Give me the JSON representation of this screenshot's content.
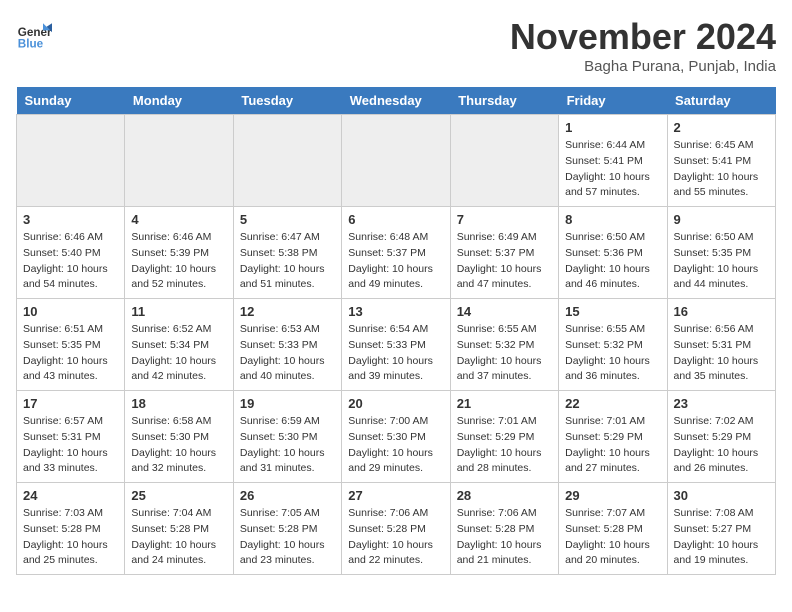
{
  "header": {
    "logo_line1": "General",
    "logo_line2": "Blue",
    "month": "November 2024",
    "location": "Bagha Purana, Punjab, India"
  },
  "weekdays": [
    "Sunday",
    "Monday",
    "Tuesday",
    "Wednesday",
    "Thursday",
    "Friday",
    "Saturday"
  ],
  "weeks": [
    [
      {
        "day": "",
        "info": ""
      },
      {
        "day": "",
        "info": ""
      },
      {
        "day": "",
        "info": ""
      },
      {
        "day": "",
        "info": ""
      },
      {
        "day": "",
        "info": ""
      },
      {
        "day": "1",
        "info": "Sunrise: 6:44 AM\nSunset: 5:41 PM\nDaylight: 10 hours\nand 57 minutes."
      },
      {
        "day": "2",
        "info": "Sunrise: 6:45 AM\nSunset: 5:41 PM\nDaylight: 10 hours\nand 55 minutes."
      }
    ],
    [
      {
        "day": "3",
        "info": "Sunrise: 6:46 AM\nSunset: 5:40 PM\nDaylight: 10 hours\nand 54 minutes."
      },
      {
        "day": "4",
        "info": "Sunrise: 6:46 AM\nSunset: 5:39 PM\nDaylight: 10 hours\nand 52 minutes."
      },
      {
        "day": "5",
        "info": "Sunrise: 6:47 AM\nSunset: 5:38 PM\nDaylight: 10 hours\nand 51 minutes."
      },
      {
        "day": "6",
        "info": "Sunrise: 6:48 AM\nSunset: 5:37 PM\nDaylight: 10 hours\nand 49 minutes."
      },
      {
        "day": "7",
        "info": "Sunrise: 6:49 AM\nSunset: 5:37 PM\nDaylight: 10 hours\nand 47 minutes."
      },
      {
        "day": "8",
        "info": "Sunrise: 6:50 AM\nSunset: 5:36 PM\nDaylight: 10 hours\nand 46 minutes."
      },
      {
        "day": "9",
        "info": "Sunrise: 6:50 AM\nSunset: 5:35 PM\nDaylight: 10 hours\nand 44 minutes."
      }
    ],
    [
      {
        "day": "10",
        "info": "Sunrise: 6:51 AM\nSunset: 5:35 PM\nDaylight: 10 hours\nand 43 minutes."
      },
      {
        "day": "11",
        "info": "Sunrise: 6:52 AM\nSunset: 5:34 PM\nDaylight: 10 hours\nand 42 minutes."
      },
      {
        "day": "12",
        "info": "Sunrise: 6:53 AM\nSunset: 5:33 PM\nDaylight: 10 hours\nand 40 minutes."
      },
      {
        "day": "13",
        "info": "Sunrise: 6:54 AM\nSunset: 5:33 PM\nDaylight: 10 hours\nand 39 minutes."
      },
      {
        "day": "14",
        "info": "Sunrise: 6:55 AM\nSunset: 5:32 PM\nDaylight: 10 hours\nand 37 minutes."
      },
      {
        "day": "15",
        "info": "Sunrise: 6:55 AM\nSunset: 5:32 PM\nDaylight: 10 hours\nand 36 minutes."
      },
      {
        "day": "16",
        "info": "Sunrise: 6:56 AM\nSunset: 5:31 PM\nDaylight: 10 hours\nand 35 minutes."
      }
    ],
    [
      {
        "day": "17",
        "info": "Sunrise: 6:57 AM\nSunset: 5:31 PM\nDaylight: 10 hours\nand 33 minutes."
      },
      {
        "day": "18",
        "info": "Sunrise: 6:58 AM\nSunset: 5:30 PM\nDaylight: 10 hours\nand 32 minutes."
      },
      {
        "day": "19",
        "info": "Sunrise: 6:59 AM\nSunset: 5:30 PM\nDaylight: 10 hours\nand 31 minutes."
      },
      {
        "day": "20",
        "info": "Sunrise: 7:00 AM\nSunset: 5:30 PM\nDaylight: 10 hours\nand 29 minutes."
      },
      {
        "day": "21",
        "info": "Sunrise: 7:01 AM\nSunset: 5:29 PM\nDaylight: 10 hours\nand 28 minutes."
      },
      {
        "day": "22",
        "info": "Sunrise: 7:01 AM\nSunset: 5:29 PM\nDaylight: 10 hours\nand 27 minutes."
      },
      {
        "day": "23",
        "info": "Sunrise: 7:02 AM\nSunset: 5:29 PM\nDaylight: 10 hours\nand 26 minutes."
      }
    ],
    [
      {
        "day": "24",
        "info": "Sunrise: 7:03 AM\nSunset: 5:28 PM\nDaylight: 10 hours\nand 25 minutes."
      },
      {
        "day": "25",
        "info": "Sunrise: 7:04 AM\nSunset: 5:28 PM\nDaylight: 10 hours\nand 24 minutes."
      },
      {
        "day": "26",
        "info": "Sunrise: 7:05 AM\nSunset: 5:28 PM\nDaylight: 10 hours\nand 23 minutes."
      },
      {
        "day": "27",
        "info": "Sunrise: 7:06 AM\nSunset: 5:28 PM\nDaylight: 10 hours\nand 22 minutes."
      },
      {
        "day": "28",
        "info": "Sunrise: 7:06 AM\nSunset: 5:28 PM\nDaylight: 10 hours\nand 21 minutes."
      },
      {
        "day": "29",
        "info": "Sunrise: 7:07 AM\nSunset: 5:28 PM\nDaylight: 10 hours\nand 20 minutes."
      },
      {
        "day": "30",
        "info": "Sunrise: 7:08 AM\nSunset: 5:27 PM\nDaylight: 10 hours\nand 19 minutes."
      }
    ]
  ]
}
